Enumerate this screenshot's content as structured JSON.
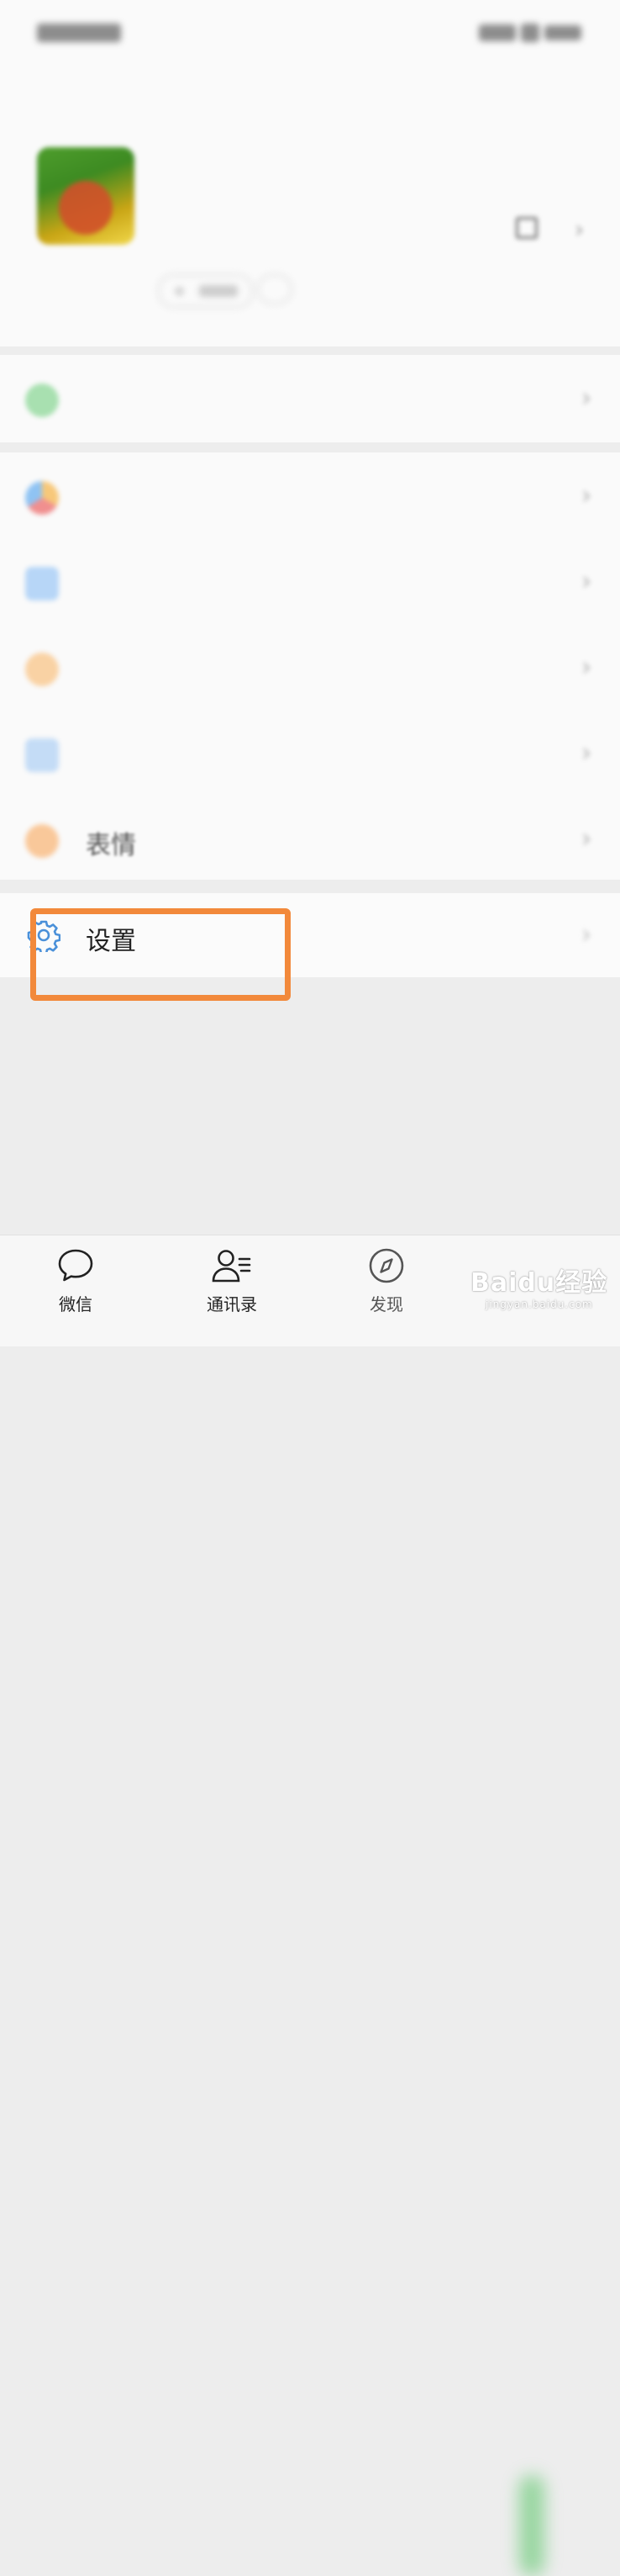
{
  "status_bar": {
    "time": "",
    "indicators": ""
  },
  "profile": {
    "nickname": "",
    "wechat_id": "",
    "status_button": ""
  },
  "menu": {
    "service": {
      "label": "",
      "icon": "service-icon"
    },
    "favorites": {
      "label": "",
      "icon": "favorites-icon"
    },
    "moments": {
      "label": "",
      "icon": "moments-icon"
    },
    "channels": {
      "label": "",
      "icon": "channels-icon"
    },
    "cards": {
      "label": "",
      "icon": "cards-icon"
    },
    "stickers": {
      "label": "表情",
      "icon": "sticker-icon"
    },
    "settings": {
      "label": "设置",
      "icon": "gear-icon",
      "highlighted": true
    }
  },
  "tabs": [
    {
      "label": "微信",
      "icon": "chat-bubble-icon"
    },
    {
      "label": "通讯录",
      "icon": "contacts-icon"
    },
    {
      "label": "发现",
      "icon": "compass-icon"
    }
  ],
  "watermark": {
    "brand": "Baidu经验",
    "url": "jingyan.baidu.com"
  },
  "colors": {
    "highlight": "#f2893b",
    "background": "#ededed",
    "accent_green": "#5cc66a"
  }
}
